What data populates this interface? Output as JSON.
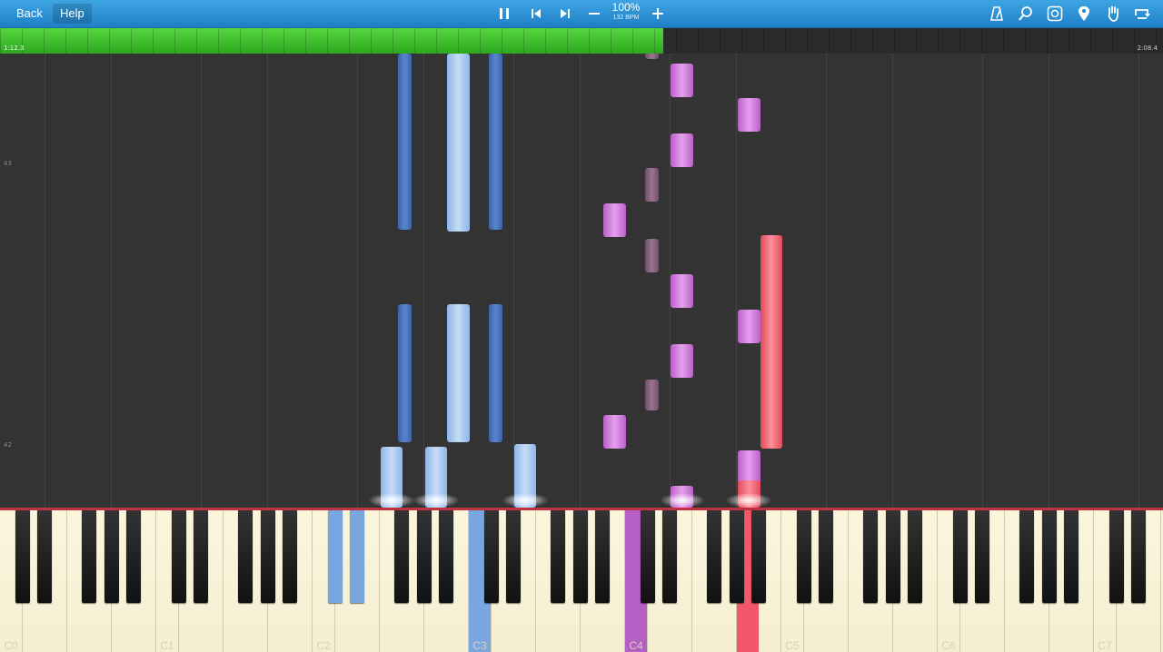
{
  "toolbar": {
    "back_label": "Back",
    "help_label": "Help",
    "tempo_percent": "100%",
    "tempo_bpm": "132 BPM",
    "icons": [
      "pause-icon",
      "skip-back-icon",
      "skip-forward-icon",
      "minus-icon",
      "plus-icon",
      "metronome-icon",
      "search-icon",
      "loop-icon",
      "marker-icon",
      "hand-icon",
      "rotate-icon"
    ]
  },
  "progress": {
    "current_time": "1:12.3",
    "total_time": "2:08.4",
    "fraction": 0.57
  },
  "roll": {
    "measure_labels": [
      "43",
      "42"
    ]
  },
  "keyboard": {
    "octave_labels": [
      "C0",
      "C1",
      "C2",
      "C3",
      "C4",
      "C5",
      "C6",
      "C7"
    ],
    "active_keys": [
      {
        "key": "C#2",
        "color": "#7aa6e0"
      },
      {
        "key": "D#2",
        "color": "#7aa6e0"
      },
      {
        "key": "C3",
        "color": "#7aa6e0"
      },
      {
        "key": "C4",
        "color": "#b55fc5"
      },
      {
        "key": "A4",
        "color": "#f2586a"
      }
    ]
  },
  "colors": {
    "toolbar": "#2a8fd6",
    "progress": "#3fbf2d",
    "background": "#333333",
    "blue_note": "#5b85cf",
    "light_blue_note": "#c6dcf7",
    "pink_note": "#e6a0ee",
    "red_note": "#f2586a"
  }
}
